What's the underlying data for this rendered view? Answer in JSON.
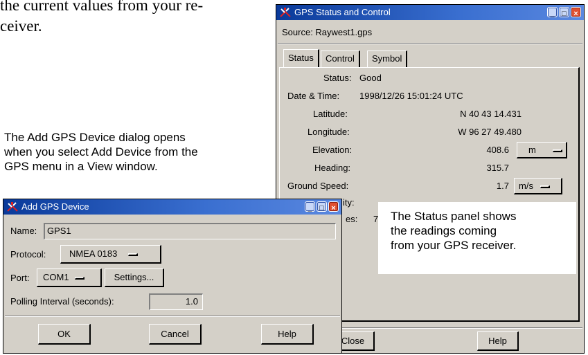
{
  "document": {
    "top_text_line1": "the current values from your re-",
    "top_text_line2": "ceiver.",
    "add_device_caption": [
      "The Add GPS Device dialog opens",
      "when you select Add Device from the",
      "GPS menu in a View window."
    ],
    "status_callout": [
      "The Status panel shows",
      "the readings coming",
      "from your GPS receiver."
    ]
  },
  "gps_window": {
    "title": "GPS Status and Control",
    "source_label": "Source: Raywest1.gps",
    "tabs": [
      "Status",
      "Control",
      "Symbol"
    ],
    "status": {
      "status_label": "Status:",
      "status_value": "Good",
      "datetime_label": "Date & Time:",
      "datetime_value": "1998/12/26 15:01:24 UTC",
      "latitude_label": "Latitude:",
      "latitude_value": "N 40 43 14.431",
      "longitude_label": "Longitude:",
      "longitude_value": "W 96 27 49.480",
      "elevation_label": "Elevation:",
      "elevation_value": "408.6",
      "elevation_unit": "m",
      "heading_label": "Heading:",
      "heading_value": "315.7",
      "ground_speed_label": "Ground Speed:",
      "ground_speed_value": "1.7",
      "ground_speed_unit": "m/s",
      "partial_label_1": "ity:",
      "partial_label_2": "es:",
      "partial_value_2": "7"
    },
    "close_button": "Close",
    "help_button": "Help"
  },
  "add_device_dialog": {
    "title": "Add GPS Device",
    "name_label": "Name:",
    "name_value": "GPS1",
    "protocol_label": "Protocol:",
    "protocol_value": "NMEA 0183",
    "port_label": "Port:",
    "port_value": "COM1",
    "settings_button": "Settings...",
    "polling_label": "Polling Interval (seconds):",
    "polling_value": "1.0",
    "ok_button": "OK",
    "cancel_button": "Cancel",
    "help_button": "Help"
  },
  "icons": {
    "window_icon": "gps-satellite-icon",
    "minimize": "minimize-icon",
    "maximize": "maximize-icon",
    "close": "close-icon"
  },
  "colors": {
    "window_face": "#d4d0c8",
    "titlebar": "#2a5bc0",
    "close_button": "#e05030"
  }
}
